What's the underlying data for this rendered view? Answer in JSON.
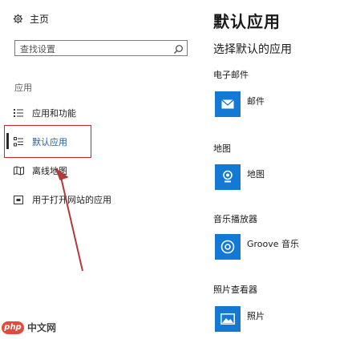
{
  "nav": {
    "home_label": "主页",
    "search_placeholder": "查找设置",
    "section_label": "应用",
    "items": [
      {
        "label": "应用和功能",
        "icon": "apps-list-icon"
      },
      {
        "label": "默认应用",
        "icon": "default-apps-icon"
      },
      {
        "label": "离线地图",
        "icon": "offline-maps-icon"
      },
      {
        "label": "用于打开网站的应用",
        "icon": "web-apps-icon"
      }
    ],
    "active_index": 1
  },
  "content": {
    "title": "默认应用",
    "subtitle": "选择默认的应用",
    "categories": [
      {
        "label": "电子邮件",
        "app": "邮件",
        "icon": "mail-icon"
      },
      {
        "label": "地图",
        "app": "地图",
        "icon": "maps-icon"
      },
      {
        "label": "音乐播放器",
        "app": "Groove 音乐",
        "icon": "groove-music-icon"
      },
      {
        "label": "照片查看器",
        "app": "照片",
        "icon": "photos-icon"
      }
    ]
  },
  "colors": {
    "tile": "#1379d4",
    "annotation": "#d0202a"
  },
  "watermark": {
    "logo_text": "php",
    "text": "中文网"
  }
}
